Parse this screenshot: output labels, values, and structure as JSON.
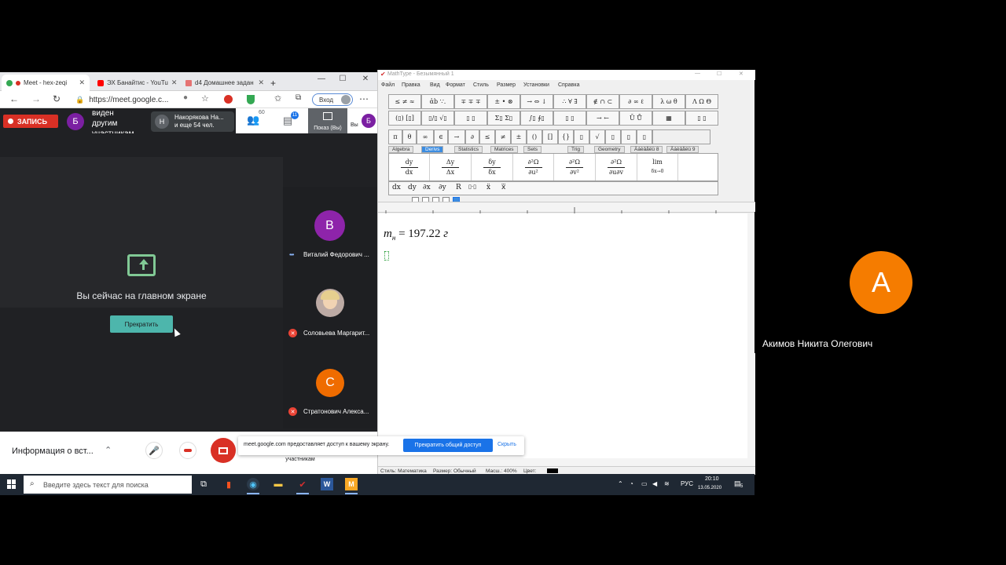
{
  "browser": {
    "tabs": [
      {
        "label": "Meet - hex-zeqi",
        "color": "#34a853"
      },
      {
        "label": "ЭХ Банайтис - YouTu",
        "color": "#ff0000"
      },
      {
        "label": "d4 Домашнее задан",
        "color": "#e57373"
      }
    ],
    "new_tab": "+",
    "url": "https://meet.google.c...",
    "signin_label": "Вход",
    "controls": {
      "minimize": "—",
      "maximize": "☐",
      "close": "✕"
    }
  },
  "meet": {
    "record_label": "ЗАПИСЬ",
    "presenter_initial": "Б",
    "share_status": [
      "виден",
      "другим",
      "участникам"
    ],
    "pill": {
      "initial": "Н",
      "line1": "Накорякова На...",
      "line2": "и еще 54 чел."
    },
    "people_count": "60",
    "chat_count": "11",
    "present_label": "Показ (Вы)",
    "you_label": "Вы",
    "you_initial": "Б",
    "main_message": "Вы сейчас на главном экране",
    "stop_button": "Прекратить",
    "participants": [
      {
        "initial": "В",
        "name": "Виталий Федорович ...",
        "color": "#8e24aa",
        "muted": false
      },
      {
        "initial": "",
        "name": "Соловьева Маргарит...",
        "color": "#bcaaa4",
        "muted": true
      },
      {
        "initial": "С",
        "name": "Стратонович Алекса...",
        "color": "#ef6c00",
        "muted": true
      }
    ],
    "bottom": {
      "info_label": "Информация о вст...",
      "sharing_notice": "Ваш экран виден другим участникам"
    }
  },
  "share_bar": {
    "message": "meet.google.com предоставляет доступ к вашему экрану.",
    "stop_label": "Прекратить общий доступ",
    "hide_label": "Скрыть"
  },
  "mathtype": {
    "title": "MathType - Безымянный 1",
    "menu": [
      "Файл",
      "Правка",
      "Вид",
      "Формат",
      "Стиль",
      "Размер",
      "Установки",
      "Справка"
    ],
    "palette_row1": [
      "≤ ≠ ≈",
      "ἀb ∵.",
      "∓ ∓ ∓",
      "± • ⊗",
      "→ ⇔ ↓",
      "∴ ∀ ∃",
      "∉ ∩ ⊂",
      "∂ ∞ ℓ",
      "λ ω θ",
      "Λ Ω Θ"
    ],
    "palette_row2": [
      "(▯) [▯]",
      "▯/▯ √▯",
      "▯ ▯",
      "Σ▯ Σ▯",
      "∫▯ ∮▯",
      "▯ ▯",
      "→ ←",
      "Ū Ů",
      "▦",
      "▯ ▯"
    ],
    "palette_row3": [
      "π",
      "θ",
      "∞",
      "∈",
      "→",
      "∂",
      "≤",
      "≠",
      "±",
      "()",
      "[]",
      "{}",
      "▯",
      "√",
      "▯",
      "▯",
      "▯"
    ],
    "tabs": [
      "Algebra",
      "Derivs",
      "Statistics",
      "Matrices",
      "Sets",
      "Trig",
      "Geometry",
      "Àáèâåëü 8",
      "Àáèâåëü 9"
    ],
    "selected_tab": "Derivs",
    "templates": [
      {
        "num": "dy",
        "den": "dx"
      },
      {
        "num": "Δy",
        "den": "Δx"
      },
      {
        "num": "δy",
        "den": "δx"
      },
      {
        "num": "∂²Ω",
        "den": "∂u²"
      },
      {
        "num": "∂²Ω",
        "den": "∂v²"
      },
      {
        "num": "∂²Ω",
        "den": "∂u∂v"
      },
      {
        "num": "lim",
        "den": "δx→0"
      }
    ],
    "small_row": [
      "dx",
      "dy",
      "∂x",
      "∂y",
      "R",
      "▯·▯",
      "ẍ",
      "x⃛"
    ],
    "equation": {
      "var": "m",
      "sub": "н",
      "rest": " = 197.22 ",
      "unit": "г"
    },
    "status": {
      "style": "Стиль: Математика",
      "size": "Размер: Обычный",
      "zoom": "Масш.: 400%",
      "color": "Цвет:"
    }
  },
  "taskbar": {
    "search_placeholder": "Введите здесь текст для поиска",
    "lang": "РУС",
    "time": "20:10",
    "date": "13.05.2020",
    "notifications": "5"
  },
  "remote": {
    "initial": "А",
    "name": "Акимов Никита Олегович",
    "avatar_color": "#f57c00"
  }
}
